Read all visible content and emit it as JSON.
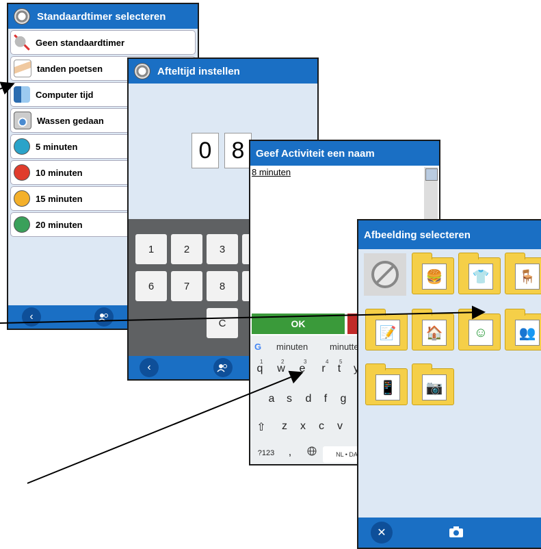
{
  "window1": {
    "title": "Standaardtimer selecteren",
    "items": [
      {
        "label": "Geen standaardtimer",
        "icon": "no-timer-icon"
      },
      {
        "label": "tanden poetsen",
        "icon": "toothbrush-icon"
      },
      {
        "label": "Computer tijd",
        "icon": "computer-icon"
      },
      {
        "label": "Wassen gedaan",
        "icon": "washing-machine-icon"
      },
      {
        "label": "5 minuten",
        "color": "#2aa3c9"
      },
      {
        "label": "10 minuten",
        "color": "#e03c2c"
      },
      {
        "label": "15 minuten",
        "color": "#f4b02a"
      },
      {
        "label": "20 minuten",
        "color": "#3aa05a"
      }
    ],
    "back_glyph": "‹"
  },
  "window2": {
    "title": "Afteltijd instellen",
    "digits": [
      "0",
      "8"
    ],
    "keys": [
      "1",
      "2",
      "3",
      "6",
      "7",
      "8",
      "C"
    ],
    "back_glyph": "‹"
  },
  "window3": {
    "title": "Geef Activiteit een naam",
    "text_value": "8 minuten",
    "ok_label": "OK",
    "suggestions": [
      "minuten",
      "minutter"
    ],
    "keyboard_row1": [
      "q",
      "w",
      "e",
      "r",
      "t",
      "y"
    ],
    "keyboard_row1_nums": [
      "1",
      "2",
      "3",
      "4",
      "5",
      "6"
    ],
    "keyboard_row2": [
      "a",
      "s",
      "d",
      "f",
      "g"
    ],
    "keyboard_row3": [
      "z",
      "x",
      "c",
      "v"
    ],
    "key_123": "?123",
    "key_comma": ",",
    "space_label": "NL • DA",
    "google_glyph": "G",
    "shift_glyph": "⇧"
  },
  "window4": {
    "title": "Afbeelding selecteren",
    "close_glyph": "✕"
  },
  "colors": {
    "title_bar": "#1a6fc4",
    "dark_btn": "#0e4f99",
    "ok_green": "#3a9a3a",
    "cancel_red": "#c12a2a",
    "folder": "#f5cf48"
  }
}
